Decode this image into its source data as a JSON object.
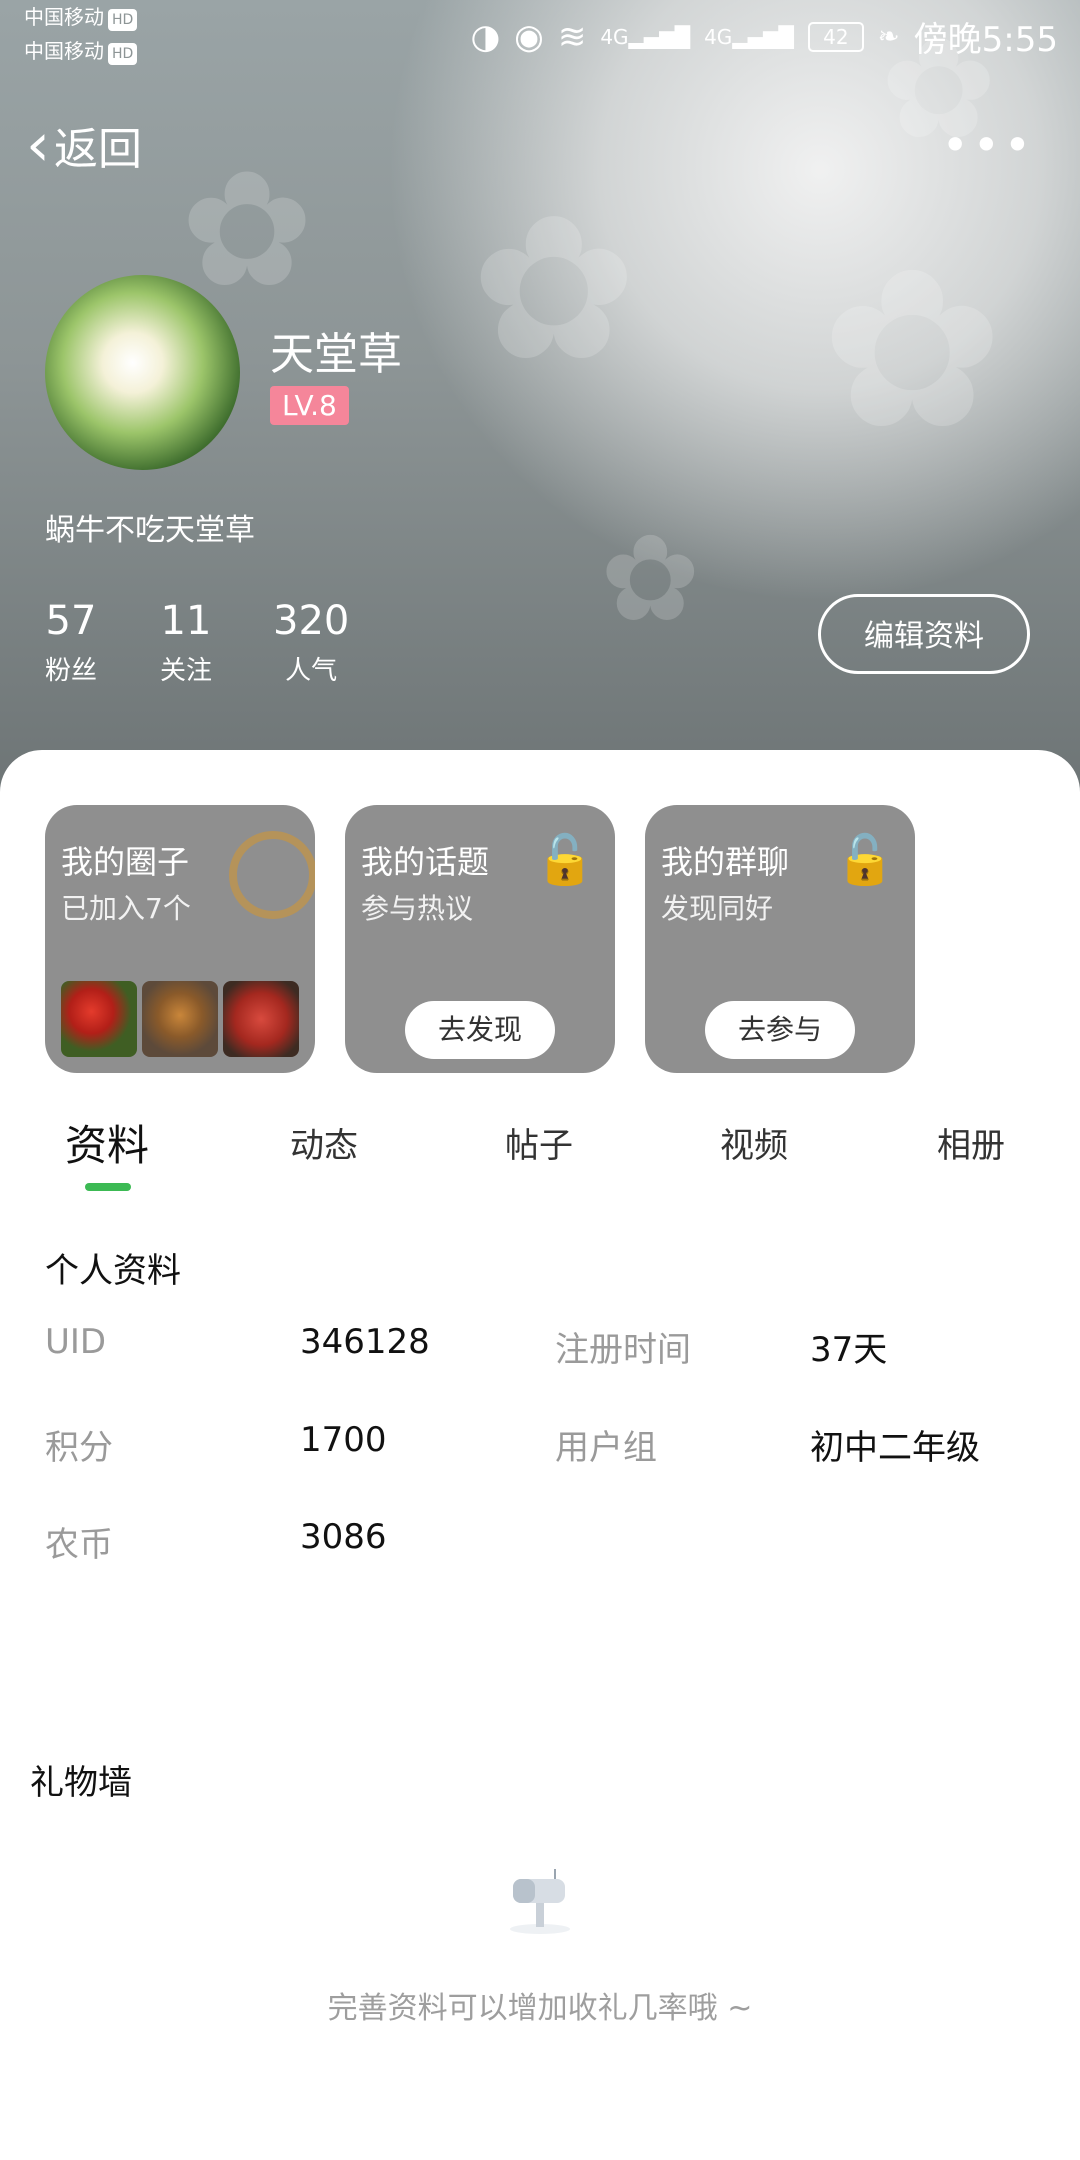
{
  "status_bar": {
    "carriers": [
      "中国移动",
      "中国移动"
    ],
    "hd_badge": "HD",
    "signal_labels": [
      "4G",
      "4G"
    ],
    "battery": "42",
    "time": "傍晚5:55"
  },
  "nav": {
    "back_label": "返回",
    "more_label": "•••"
  },
  "profile": {
    "username": "天堂草",
    "level": "LV.8",
    "bio": "蜗牛不吃天堂草",
    "stats": [
      {
        "value": "57",
        "label": "粉丝"
      },
      {
        "value": "11",
        "label": "关注"
      },
      {
        "value": "320",
        "label": "人气"
      }
    ],
    "edit_button": "编辑资料"
  },
  "cards": [
    {
      "title": "我的圈子",
      "subtitle": "已加入7个"
    },
    {
      "title": "我的话题",
      "subtitle": "参与热议",
      "button": "去发现"
    },
    {
      "title": "我的群聊",
      "subtitle": "发现同好",
      "button": "去参与"
    }
  ],
  "tabs": [
    "资料",
    "动态",
    "帖子",
    "视频",
    "相册"
  ],
  "active_tab": "资料",
  "info": {
    "section_title": "个人资料",
    "fields": [
      {
        "key": "UID",
        "value": "346128"
      },
      {
        "key": "注册时间",
        "value": "37天"
      },
      {
        "key": "积分",
        "value": "1700"
      },
      {
        "key": "用户组",
        "value": "初中二年级"
      },
      {
        "key": "农币",
        "value": "3086"
      }
    ]
  },
  "gift_wall": {
    "title": "礼物墙",
    "empty_message": "完善资料可以增加收礼几率哦 ~"
  },
  "colors": {
    "accent": "#3cba54",
    "level_badge": "#f5869a",
    "card_bg": "#8f8f8f"
  }
}
